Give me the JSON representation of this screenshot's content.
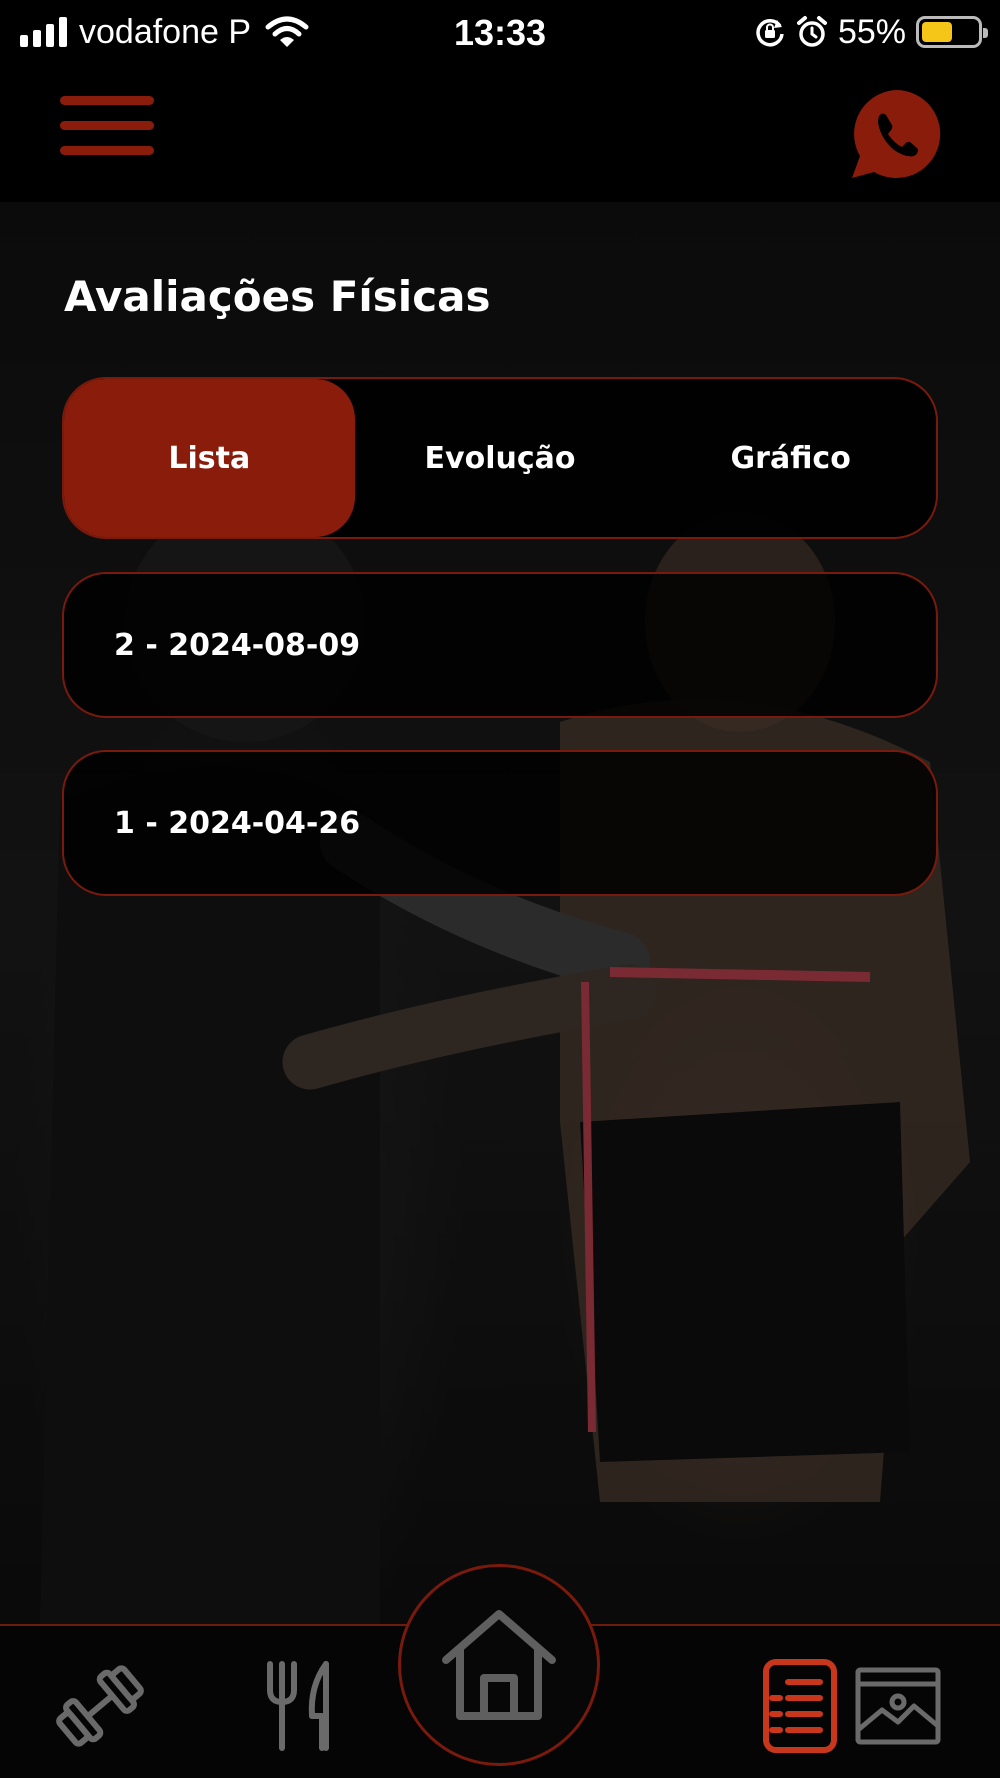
{
  "status_bar": {
    "carrier": "vodafone P",
    "time": "13:33",
    "battery_percent_text": "55%",
    "battery_level": 0.55
  },
  "header": {
    "menu_icon": "hamburger-menu-icon",
    "contact_icon": "whatsapp-icon"
  },
  "page": {
    "title": "Avaliações Físicas"
  },
  "tabs": [
    {
      "label": "Lista",
      "active": true
    },
    {
      "label": "Evolução",
      "active": false
    },
    {
      "label": "Gráfico",
      "active": false
    }
  ],
  "evaluations": [
    {
      "label": "2 - 2024-08-09"
    },
    {
      "label": "1 - 2024-04-26"
    }
  ],
  "bottom_nav": [
    {
      "icon": "dumbbell-icon",
      "active": false
    },
    {
      "icon": "fork-knife-icon",
      "active": false
    },
    {
      "icon": "home-icon",
      "active": false
    },
    {
      "icon": "clipboard-list-icon",
      "active": true
    },
    {
      "icon": "gallery-icon",
      "active": false
    }
  ],
  "colors": {
    "accent": "#8a1c0b",
    "border": "#7a1a0c",
    "active_icon": "#c8371c",
    "inactive_icon": "#6a6a6a",
    "background": "#000000",
    "battery": "#f5c518"
  }
}
